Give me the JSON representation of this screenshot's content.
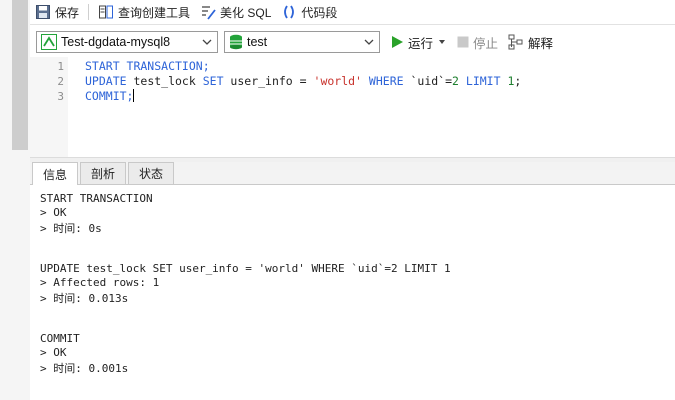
{
  "toolbar_top": {
    "save": "保存",
    "query_builder": "查询创建工具",
    "beautify": "美化 SQL",
    "snippet": "代码段"
  },
  "toolbar_conn": {
    "connection": "Test-dgdata-mysql8",
    "database": "test",
    "run": "运行",
    "stop": "停止",
    "explain": "解释"
  },
  "editor": {
    "line_numbers": [
      "1",
      "2",
      "3"
    ],
    "line1": "START TRANSACTION;",
    "line2": {
      "kw1": "UPDATE",
      "t1": " test_lock ",
      "kw2": "SET",
      "t2": " user_info = ",
      "str": "'world'",
      "t3": " ",
      "kw3": "WHERE",
      "t4": " `uid`=",
      "num1": "2",
      "t5": " ",
      "kw4": "LIMIT",
      "t6": " ",
      "num2": "1",
      "t7": ";"
    },
    "line3": "COMMIT;"
  },
  "tabs": [
    "信息",
    "剖析",
    "状态"
  ],
  "output": {
    "block1": [
      "START TRANSACTION",
      "> OK",
      "> 时间: 0s"
    ],
    "block2": [
      "UPDATE test_lock SET user_info = 'world' WHERE `uid`=2 LIMIT 1",
      "> Affected rows: 1",
      "> 时间: 0.013s"
    ],
    "block3": [
      "COMMIT",
      "> OK",
      "> 时间: 0.001s"
    ]
  },
  "colors": {
    "keyword": "#2e64d8",
    "string": "#c8322c",
    "number": "#1d7f2e",
    "run_icon": "#2aa22a",
    "database_icon": "#23a33a"
  }
}
